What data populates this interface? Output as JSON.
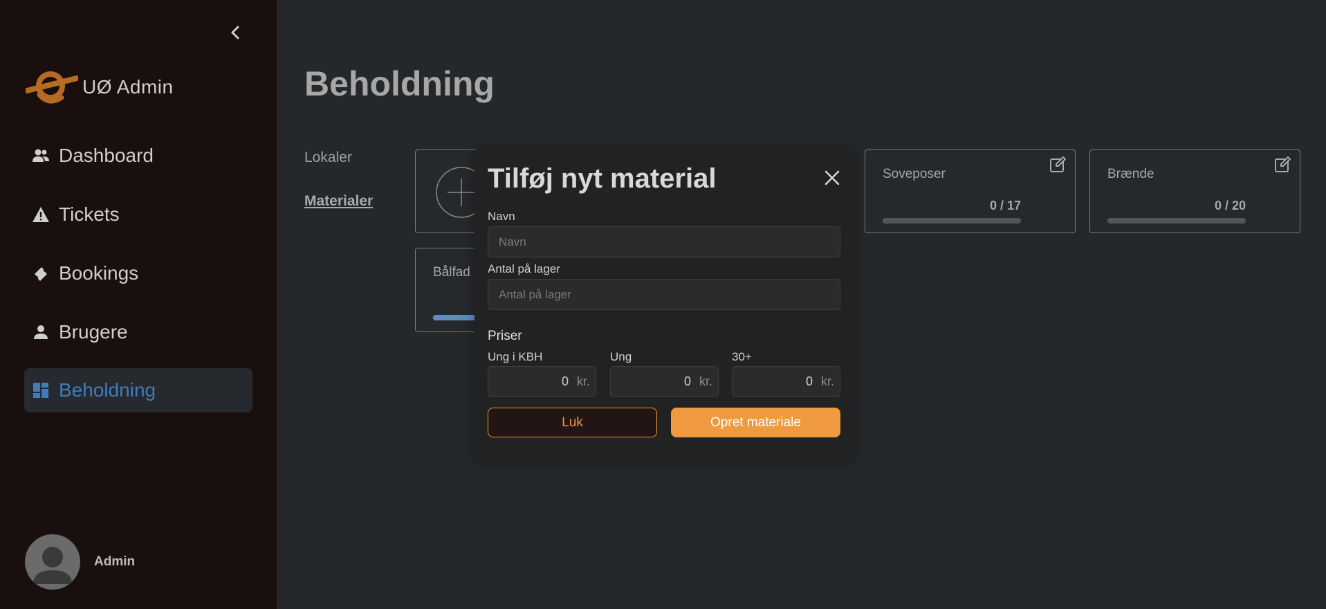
{
  "brand": {
    "name": "UØ Admin"
  },
  "sidebar": {
    "items": [
      {
        "label": "Dashboard",
        "icon": "people-icon"
      },
      {
        "label": "Tickets",
        "icon": "warning-icon"
      },
      {
        "label": "Bookings",
        "icon": "ticket-icon"
      },
      {
        "label": "Brugere",
        "icon": "person-icon"
      },
      {
        "label": "Beholdning",
        "icon": "dashboard-icon",
        "active": true
      }
    ],
    "user": {
      "name": "Admin"
    }
  },
  "page": {
    "title": "Beholdning",
    "subnav": [
      {
        "label": "Lokaler"
      },
      {
        "label": "Materialer",
        "active": true
      }
    ]
  },
  "cards": [
    {
      "title": "Soveposer",
      "count": "0 / 17",
      "fill": 0
    },
    {
      "title": "Brænde",
      "count": "0 / 20",
      "fill": 0
    },
    {
      "title": "Bålfad",
      "fill": 1
    }
  ],
  "modal": {
    "title": "Tilføj nyt material",
    "name_label": "Navn",
    "name_placeholder": "Navn",
    "stock_label": "Antal på lager",
    "stock_placeholder": "Antal på lager",
    "prices_label": "Priser",
    "prices": [
      {
        "label": "Ung i KBH",
        "value": "0",
        "unit": "kr."
      },
      {
        "label": "Ung",
        "value": "0",
        "unit": "kr."
      },
      {
        "label": "30+",
        "value": "0",
        "unit": "kr."
      }
    ],
    "close_button": "Luk",
    "create_button": "Opret materiale"
  },
  "colors": {
    "accent_orange": "#ef9a3e",
    "active_blue": "#3d7dbd",
    "sidebar_bg": "#1a0f0f",
    "main_bg": "#25282b"
  }
}
